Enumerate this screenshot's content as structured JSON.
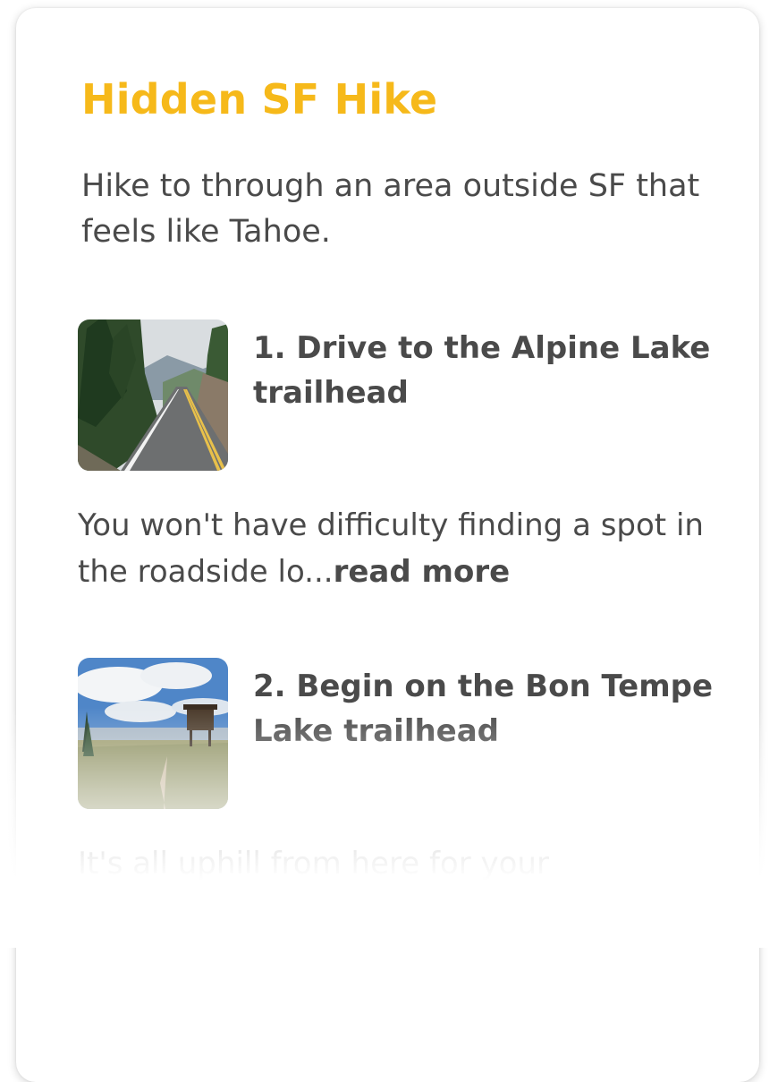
{
  "guide": {
    "title": "Hidden SF Hike",
    "description": "Hike to through an area outside SF that feels like Tahoe."
  },
  "steps": [
    {
      "title": "1. Drive to the Alpine Lake trailhead",
      "body": "You won't have difficulty finding a spot in the roadside lo...",
      "read_more": "read more",
      "image": "mountain-road-photo"
    },
    {
      "title": "2. Begin on the Bon Tempe Lake trailhead",
      "body": "It's all uphill from here for your",
      "image": "lookout-tower-meadow-photo"
    }
  ],
  "colors": {
    "title_accent": "#f6b91a",
    "text": "#4a4a4a"
  }
}
